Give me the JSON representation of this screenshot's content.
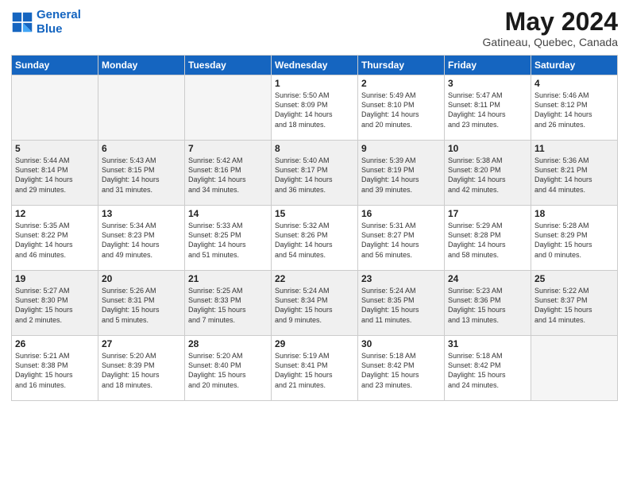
{
  "logo": {
    "line1": "General",
    "line2": "Blue"
  },
  "title": "May 2024",
  "subtitle": "Gatineau, Quebec, Canada",
  "days": [
    "Sunday",
    "Monday",
    "Tuesday",
    "Wednesday",
    "Thursday",
    "Friday",
    "Saturday"
  ],
  "weeks": [
    [
      {
        "num": "",
        "text": ""
      },
      {
        "num": "",
        "text": ""
      },
      {
        "num": "",
        "text": ""
      },
      {
        "num": "1",
        "text": "Sunrise: 5:50 AM\nSunset: 8:09 PM\nDaylight: 14 hours\nand 18 minutes."
      },
      {
        "num": "2",
        "text": "Sunrise: 5:49 AM\nSunset: 8:10 PM\nDaylight: 14 hours\nand 20 minutes."
      },
      {
        "num": "3",
        "text": "Sunrise: 5:47 AM\nSunset: 8:11 PM\nDaylight: 14 hours\nand 23 minutes."
      },
      {
        "num": "4",
        "text": "Sunrise: 5:46 AM\nSunset: 8:12 PM\nDaylight: 14 hours\nand 26 minutes."
      }
    ],
    [
      {
        "num": "5",
        "text": "Sunrise: 5:44 AM\nSunset: 8:14 PM\nDaylight: 14 hours\nand 29 minutes."
      },
      {
        "num": "6",
        "text": "Sunrise: 5:43 AM\nSunset: 8:15 PM\nDaylight: 14 hours\nand 31 minutes."
      },
      {
        "num": "7",
        "text": "Sunrise: 5:42 AM\nSunset: 8:16 PM\nDaylight: 14 hours\nand 34 minutes."
      },
      {
        "num": "8",
        "text": "Sunrise: 5:40 AM\nSunset: 8:17 PM\nDaylight: 14 hours\nand 36 minutes."
      },
      {
        "num": "9",
        "text": "Sunrise: 5:39 AM\nSunset: 8:19 PM\nDaylight: 14 hours\nand 39 minutes."
      },
      {
        "num": "10",
        "text": "Sunrise: 5:38 AM\nSunset: 8:20 PM\nDaylight: 14 hours\nand 42 minutes."
      },
      {
        "num": "11",
        "text": "Sunrise: 5:36 AM\nSunset: 8:21 PM\nDaylight: 14 hours\nand 44 minutes."
      }
    ],
    [
      {
        "num": "12",
        "text": "Sunrise: 5:35 AM\nSunset: 8:22 PM\nDaylight: 14 hours\nand 46 minutes."
      },
      {
        "num": "13",
        "text": "Sunrise: 5:34 AM\nSunset: 8:23 PM\nDaylight: 14 hours\nand 49 minutes."
      },
      {
        "num": "14",
        "text": "Sunrise: 5:33 AM\nSunset: 8:25 PM\nDaylight: 14 hours\nand 51 minutes."
      },
      {
        "num": "15",
        "text": "Sunrise: 5:32 AM\nSunset: 8:26 PM\nDaylight: 14 hours\nand 54 minutes."
      },
      {
        "num": "16",
        "text": "Sunrise: 5:31 AM\nSunset: 8:27 PM\nDaylight: 14 hours\nand 56 minutes."
      },
      {
        "num": "17",
        "text": "Sunrise: 5:29 AM\nSunset: 8:28 PM\nDaylight: 14 hours\nand 58 minutes."
      },
      {
        "num": "18",
        "text": "Sunrise: 5:28 AM\nSunset: 8:29 PM\nDaylight: 15 hours\nand 0 minutes."
      }
    ],
    [
      {
        "num": "19",
        "text": "Sunrise: 5:27 AM\nSunset: 8:30 PM\nDaylight: 15 hours\nand 2 minutes."
      },
      {
        "num": "20",
        "text": "Sunrise: 5:26 AM\nSunset: 8:31 PM\nDaylight: 15 hours\nand 5 minutes."
      },
      {
        "num": "21",
        "text": "Sunrise: 5:25 AM\nSunset: 8:33 PM\nDaylight: 15 hours\nand 7 minutes."
      },
      {
        "num": "22",
        "text": "Sunrise: 5:24 AM\nSunset: 8:34 PM\nDaylight: 15 hours\nand 9 minutes."
      },
      {
        "num": "23",
        "text": "Sunrise: 5:24 AM\nSunset: 8:35 PM\nDaylight: 15 hours\nand 11 minutes."
      },
      {
        "num": "24",
        "text": "Sunrise: 5:23 AM\nSunset: 8:36 PM\nDaylight: 15 hours\nand 13 minutes."
      },
      {
        "num": "25",
        "text": "Sunrise: 5:22 AM\nSunset: 8:37 PM\nDaylight: 15 hours\nand 14 minutes."
      }
    ],
    [
      {
        "num": "26",
        "text": "Sunrise: 5:21 AM\nSunset: 8:38 PM\nDaylight: 15 hours\nand 16 minutes."
      },
      {
        "num": "27",
        "text": "Sunrise: 5:20 AM\nSunset: 8:39 PM\nDaylight: 15 hours\nand 18 minutes."
      },
      {
        "num": "28",
        "text": "Sunrise: 5:20 AM\nSunset: 8:40 PM\nDaylight: 15 hours\nand 20 minutes."
      },
      {
        "num": "29",
        "text": "Sunrise: 5:19 AM\nSunset: 8:41 PM\nDaylight: 15 hours\nand 21 minutes."
      },
      {
        "num": "30",
        "text": "Sunrise: 5:18 AM\nSunset: 8:42 PM\nDaylight: 15 hours\nand 23 minutes."
      },
      {
        "num": "31",
        "text": "Sunrise: 5:18 AM\nSunset: 8:42 PM\nDaylight: 15 hours\nand 24 minutes."
      },
      {
        "num": "",
        "text": ""
      }
    ]
  ]
}
